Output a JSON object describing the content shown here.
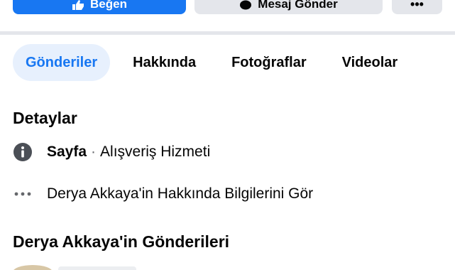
{
  "actions": {
    "primary_label": "Beğen",
    "secondary_label": "Mesaj Gönder",
    "primary_color": "#1877f2",
    "primary_icon": "like-icon",
    "secondary_icon": "messenger-icon",
    "more_icon": "more-icon"
  },
  "tabs": [
    {
      "label": "Gönderiler",
      "active": true
    },
    {
      "label": "Hakkında",
      "active": false
    },
    {
      "label": "Fotoğraflar",
      "active": false
    },
    {
      "label": "Videolar",
      "active": false
    }
  ],
  "details": {
    "title": "Detaylar",
    "page_type_label": "Sayfa",
    "page_type_sep": "·",
    "page_category": "Alışveriş Hizmeti",
    "page_type_icon": "info-icon",
    "see_about": "Derya Akkaya'in Hakkında Bilgilerini Gör",
    "see_about_icon": "ellipsis-icon"
  },
  "posts": {
    "title": "Derya Akkaya'in Gönderileri"
  }
}
